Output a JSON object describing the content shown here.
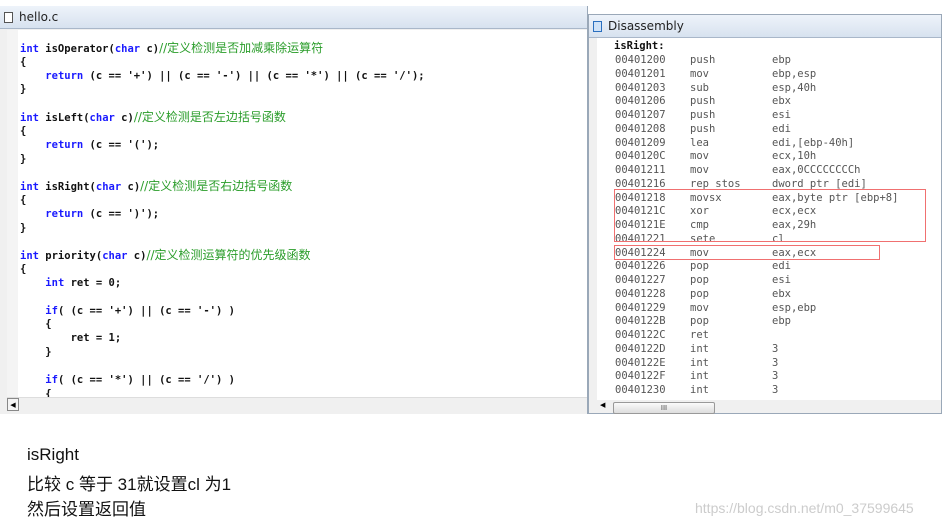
{
  "editor": {
    "title": "hello.c",
    "lines": [
      [
        [
          "int",
          "kw"
        ],
        [
          " isOperator(",
          ""
        ],
        [
          "char",
          "kw"
        ],
        [
          " c)",
          ""
        ],
        [
          "//定义检测是否加减乘除运算符",
          "cm"
        ]
      ],
      [
        [
          "{",
          ""
        ]
      ],
      [
        [
          "    ",
          ""
        ],
        [
          "return",
          "kw"
        ],
        [
          " (c == '+') || (c == '-') || (c == '*') || (c == '/');",
          ""
        ]
      ],
      [
        [
          "}",
          ""
        ]
      ],
      [],
      [
        [
          "int",
          "kw"
        ],
        [
          " isLeft(",
          ""
        ],
        [
          "char",
          "kw"
        ],
        [
          " c)",
          ""
        ],
        [
          "//定义检测是否左边括号函数",
          "cm"
        ]
      ],
      [
        [
          "{",
          ""
        ]
      ],
      [
        [
          "    ",
          ""
        ],
        [
          "return",
          "kw"
        ],
        [
          " (c == '(');",
          ""
        ]
      ],
      [
        [
          "}",
          ""
        ]
      ],
      [],
      [
        [
          "int",
          "kw"
        ],
        [
          " isRight(",
          ""
        ],
        [
          "char",
          "kw"
        ],
        [
          " c)",
          ""
        ],
        [
          "//定义检测是否右边括号函数",
          "cm"
        ]
      ],
      [
        [
          "{",
          ""
        ]
      ],
      [
        [
          "    ",
          ""
        ],
        [
          "return",
          "kw"
        ],
        [
          " (c == ')');",
          ""
        ]
      ],
      [
        [
          "}",
          ""
        ]
      ],
      [],
      [
        [
          "int",
          "kw"
        ],
        [
          " priority(",
          ""
        ],
        [
          "char",
          "kw"
        ],
        [
          " c)",
          ""
        ],
        [
          "//定义检测运算符的优先级函数",
          "cm"
        ]
      ],
      [
        [
          "{",
          ""
        ]
      ],
      [
        [
          "    ",
          ""
        ],
        [
          "int",
          "kw"
        ],
        [
          " ret = 0;",
          ""
        ]
      ],
      [],
      [
        [
          "    ",
          ""
        ],
        [
          "if",
          "kw"
        ],
        [
          "( (c == '+') || (c == '-') )",
          ""
        ]
      ],
      [
        [
          "    {",
          ""
        ]
      ],
      [
        [
          "        ret = 1;",
          ""
        ]
      ],
      [
        [
          "    }",
          ""
        ]
      ],
      [],
      [
        [
          "    ",
          ""
        ],
        [
          "if",
          "kw"
        ],
        [
          "( (c == '*') || (c == '/') )",
          ""
        ]
      ],
      [
        [
          "    {",
          ""
        ]
      ]
    ]
  },
  "disassembly": {
    "title": "Disassembly",
    "label": "isRight:",
    "rows": [
      [
        "00401200",
        "push",
        "ebp"
      ],
      [
        "00401201",
        "mov",
        "ebp,esp"
      ],
      [
        "00401203",
        "sub",
        "esp,40h"
      ],
      [
        "00401206",
        "push",
        "ebx"
      ],
      [
        "00401207",
        "push",
        "esi"
      ],
      [
        "00401208",
        "push",
        "edi"
      ],
      [
        "00401209",
        "lea",
        "edi,[ebp-40h]"
      ],
      [
        "0040120C",
        "mov",
        "ecx,10h"
      ],
      [
        "00401211",
        "mov",
        "eax,0CCCCCCCCh"
      ],
      [
        "00401216",
        "rep stos",
        "dword ptr [edi]"
      ],
      [
        "00401218",
        "movsx",
        "eax,byte ptr [ebp+8]"
      ],
      [
        "0040121C",
        "xor",
        "ecx,ecx"
      ],
      [
        "0040121E",
        "cmp",
        "eax,29h"
      ],
      [
        "00401221",
        "sete",
        "cl"
      ],
      [
        "00401224",
        "mov",
        "eax,ecx"
      ],
      [
        "00401226",
        "pop",
        "edi"
      ],
      [
        "00401227",
        "pop",
        "esi"
      ],
      [
        "00401228",
        "pop",
        "ebx"
      ],
      [
        "00401229",
        "mov",
        "esp,ebp"
      ],
      [
        "0040122B",
        "pop",
        "ebp"
      ],
      [
        "0040122C",
        "ret",
        ""
      ],
      [
        "0040122D",
        "int",
        "3"
      ],
      [
        "0040122E",
        "int",
        "3"
      ],
      [
        "0040122F",
        "int",
        "3"
      ],
      [
        "00401230",
        "int",
        "3"
      ]
    ],
    "scroll_thumb": "III",
    "highlight_color": "#f07070"
  },
  "notes": [
    "isRight",
    "比较 c 等于 31就设置cl 为1",
    "然后设置返回值"
  ],
  "watermark": "https://blog.csdn.net/m0_37599645"
}
